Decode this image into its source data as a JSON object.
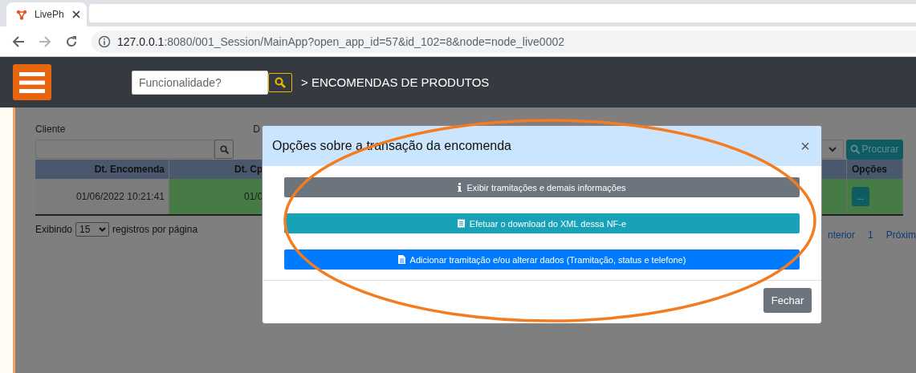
{
  "browser": {
    "tab_title": "LivePh",
    "url_host": "127.0.0.1",
    "url_rest": ":8080/001_Session/MainApp?open_app_id=57&id_102=8&node=node_live0002"
  },
  "header": {
    "search_placeholder": "Funcionalidade?",
    "breadcrumb": "> ENCOMENDAS DE PRODUTOS"
  },
  "filters": [
    {
      "label": "Cliente"
    },
    {
      "label": "D"
    }
  ],
  "search_button": "Procurar",
  "table": {
    "columns": [
      "Dt. Encomenda",
      "Dt. Cp",
      "Opções"
    ],
    "rows": [
      {
        "cells": [
          "01/06/2022 10:21:41",
          "01/0"
        ],
        "options_button": "..."
      }
    ]
  },
  "page_size": {
    "prefix": "Exibindo",
    "value": "15",
    "suffix": "registros por página"
  },
  "pagination": [
    "nterior",
    "1",
    "Próxim"
  ],
  "modal": {
    "title": "Opções sobre a transação da encomenda",
    "close": "×",
    "actions": [
      {
        "kind": "info",
        "label": "Exibir tramitações e demais informações",
        "color": "#6c757d"
      },
      {
        "kind": "receipt",
        "label": "Efetuar o download do XML dessa NF-e",
        "color": "#17a2b8"
      },
      {
        "kind": "document",
        "label": "Adicionar tramitação e/ou alterar dados (Tramitação, status e telefone)",
        "color": "#007bff"
      }
    ],
    "close_button": "Fechar"
  }
}
